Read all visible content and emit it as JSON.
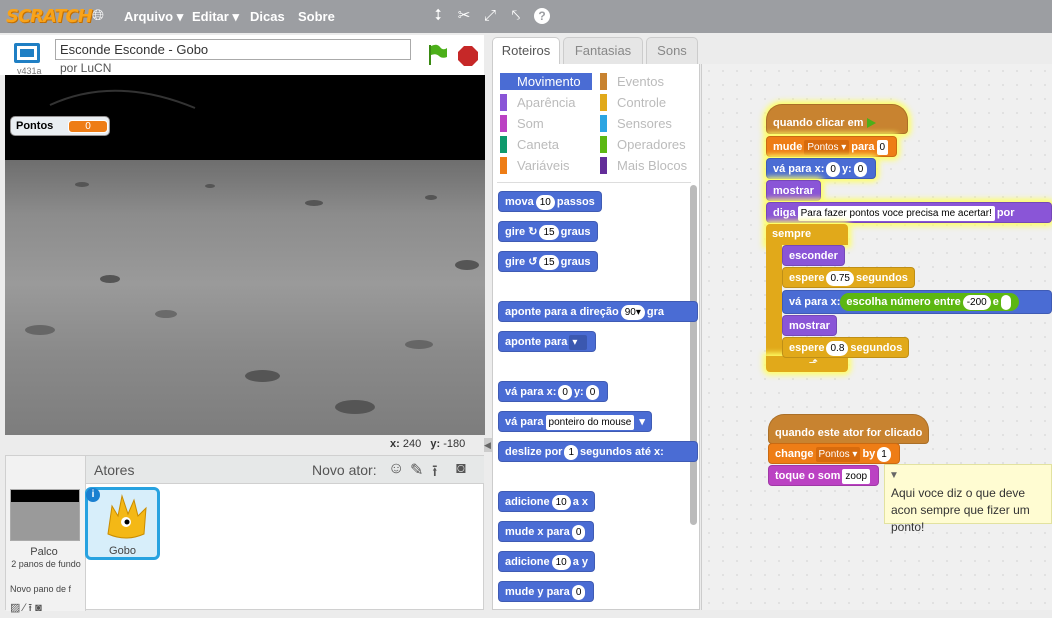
{
  "menubar": {
    "logo": "SCRATCH",
    "items": [
      "Arquivo ▾",
      "Editar ▾",
      "Dicas",
      "Sobre"
    ]
  },
  "stage_header": {
    "version": "v431a",
    "project_title": "Esconde Esconde - Gobo",
    "author": "por LuCN"
  },
  "stage": {
    "monitor_label": "Pontos",
    "monitor_value": "0",
    "coords_x_label": "x:",
    "coords_x": "240",
    "coords_y_label": "y:",
    "coords_y": "-180"
  },
  "sprites": {
    "header": "Atores",
    "new_sprite_label": "Novo ator:",
    "stage_label": "Palco",
    "stage_backdrops": "2 panos de fundo",
    "new_backdrop": "Novo pano de f",
    "sprite_name": "Gobo"
  },
  "tabs": [
    "Roteiros",
    "Fantasias",
    "Sons"
  ],
  "categories": [
    {
      "label": "Movimento",
      "color": "#4a6cd4"
    },
    {
      "label": "Eventos",
      "color": "#c88330"
    },
    {
      "label": "Aparência",
      "color": "#8a55d7"
    },
    {
      "label": "Controle",
      "color": "#e1a91a"
    },
    {
      "label": "Som",
      "color": "#bb42c3"
    },
    {
      "label": "Sensores",
      "color": "#2ca5e2"
    },
    {
      "label": "Caneta",
      "color": "#0e9a6c"
    },
    {
      "label": "Operadores",
      "color": "#5cb712"
    },
    {
      "label": "Variáveis",
      "color": "#ee7d16"
    },
    {
      "label": "Mais Blocos",
      "color": "#632d99"
    }
  ],
  "palette_blocks": {
    "move": "mova",
    "move_val": "10",
    "move_unit": "passos",
    "turn_right": "gire",
    "turn_right_val": "15",
    "turn_right_unit": "graus",
    "turn_left": "gire",
    "turn_left_val": "15",
    "turn_left_unit": "graus",
    "point_dir": "aponte para a direção",
    "point_dir_val": "90▾",
    "point_dir_tail": "gra",
    "point_towards": "aponte para",
    "goto_xy": "vá para x:",
    "goto_x": "0",
    "goto_y_label": "y:",
    "goto_y": "0",
    "goto": "vá para",
    "goto_target": "ponteiro do mouse",
    "glide": "deslize por",
    "glide_val": "1",
    "glide_tail": "segundos até x:",
    "change_x": "adicione",
    "change_x_val": "10",
    "change_x_tail": "a x",
    "set_x": "mude x para",
    "set_x_val": "0",
    "change_y": "adicione",
    "change_y_val": "10",
    "change_y_tail": "a y",
    "set_y": "mude y para",
    "set_y_val": "0"
  },
  "script1": {
    "hat": "quando clicar em",
    "set": "mude",
    "set_var": "Pontos ▾",
    "set_to": "para",
    "set_val": "0",
    "goto": "vá para x:",
    "goto_x": "0",
    "goto_y_label": "y:",
    "goto_y": "0",
    "show": "mostrar",
    "say": "diga",
    "say_text": "Para fazer pontos voce precisa me acertar!",
    "say_tail": "por",
    "forever": "sempre",
    "hide": "esconder",
    "wait1": "espere",
    "wait1_val": "0.75",
    "wait1_unit": "segundos",
    "goto2": "vá para x:",
    "pick": "escolha número entre",
    "pick_from": "-200",
    "pick_and": "e",
    "show2": "mostrar",
    "wait2": "espere",
    "wait2_val": "0.8",
    "wait2_unit": "segundos"
  },
  "script2": {
    "hat": "quando este ator for clicado",
    "change": "change",
    "change_var": "Pontos ▾",
    "change_by": "by",
    "change_val": "1",
    "sound": "toque o som",
    "sound_val": "zoop"
  },
  "comment": "Aqui voce diz o que deve acon sempre que fizer um ponto!"
}
